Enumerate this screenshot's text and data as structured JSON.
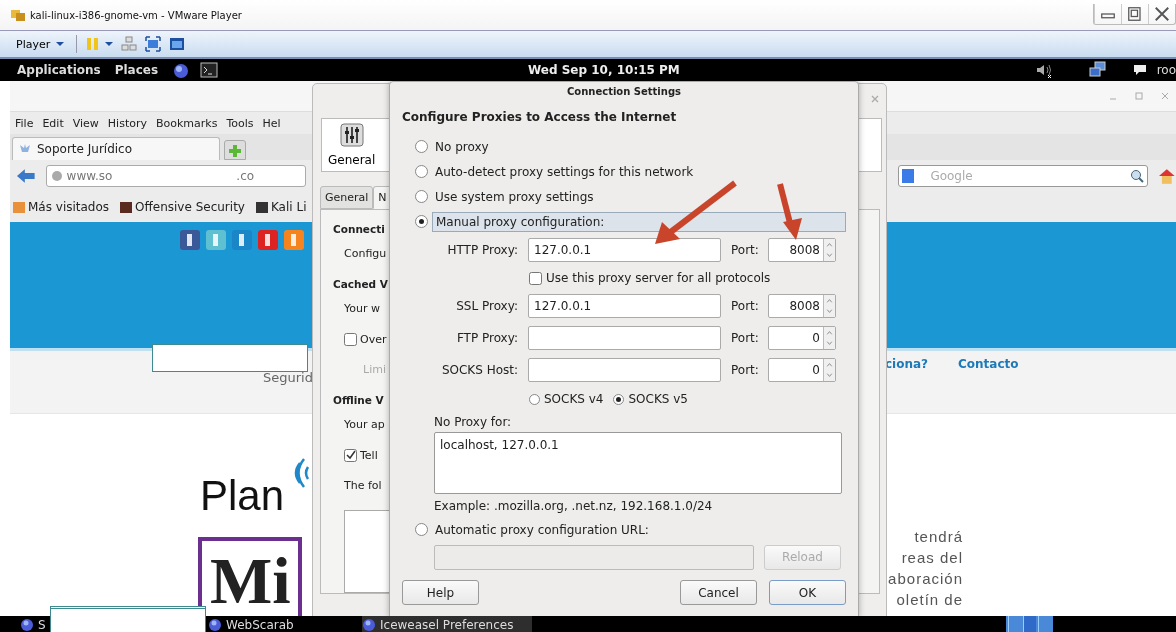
{
  "vm_window": {
    "title": "kali-linux-i386-gnome-vm - VMware Player",
    "player_menu": "Player"
  },
  "top_bar": {
    "menus": [
      "Applications",
      "Places"
    ],
    "clock": "Wed Sep 10, 10:15 PM",
    "user": "roo"
  },
  "browser": {
    "menu": [
      "File",
      "Edit",
      "View",
      "History",
      "Bookmarks",
      "Tools",
      "Hel"
    ],
    "tabs": [
      {
        "label": "Soporte Jurídico",
        "selected": true
      }
    ],
    "url_start": "www.so",
    "url_end": ".co",
    "search": {
      "placeholder": "Google"
    },
    "bookmarks": [
      "Más visitados",
      "Offensive Security",
      "Kali Li"
    ],
    "page": {
      "nav_left": "Segurid",
      "nav_right": [
        "ciona?",
        "Contacto"
      ],
      "logo_text": "Plan",
      "logo_box": "Mi",
      "body_lines": [
        "tendrá",
        "reas del",
        "aboración",
        "oletín de"
      ]
    }
  },
  "preferences": {
    "toolbar_item": "General",
    "tabs": [
      {
        "label": "General",
        "selected": false
      },
      {
        "label": "N",
        "selected": true
      }
    ],
    "items": [
      {
        "kind": "heading",
        "text": "Connecti"
      },
      {
        "kind": "text",
        "text": "Configu"
      },
      {
        "kind": "heading",
        "text": "Cached V"
      },
      {
        "kind": "text",
        "text": "Your w"
      },
      {
        "kind": "checkbox",
        "text": "Over",
        "checked": false
      },
      {
        "kind": "disabled",
        "text": "Limi"
      },
      {
        "kind": "heading",
        "text": "Offline V"
      },
      {
        "kind": "text",
        "text": "Your ap"
      },
      {
        "kind": "checkbox",
        "text": "Tell",
        "checked": true
      },
      {
        "kind": "text",
        "text": "The fol"
      },
      {
        "kind": "list"
      }
    ]
  },
  "dialog": {
    "title": "Connection Settings",
    "heading": "Configure Proxies to Access the Internet",
    "modes": [
      {
        "label": "No proxy",
        "selected": false
      },
      {
        "label": "Auto-detect proxy settings for this network",
        "selected": false
      },
      {
        "label": "Use system proxy settings",
        "selected": false
      },
      {
        "label": "Manual proxy configuration:",
        "selected": true
      }
    ],
    "proxies": [
      {
        "label": "HTTP Proxy:",
        "value": "127.0.0.1",
        "port_label": "Port:",
        "port": "8008"
      },
      {
        "label": "SSL Proxy:",
        "value": "127.0.0.1",
        "port_label": "Port:",
        "port": "8008"
      },
      {
        "label": "FTP Proxy:",
        "port_label": "Port:",
        "port": "0"
      },
      {
        "label": "SOCKS Host:",
        "port_label": "Port:",
        "port": "0"
      }
    ],
    "share_all": {
      "label": "Use this proxy server for all protocols",
      "checked": false
    },
    "socks_versions": [
      {
        "label": "SOCKS v4",
        "selected": false
      },
      {
        "label": "SOCKS v5",
        "selected": true
      }
    ],
    "no_proxy_label": "No Proxy for:",
    "no_proxy": "localhost, 127.0.0.1",
    "example": "Example: .mozilla.org, .net.nz, 192.168.1.0/24",
    "auto_url": {
      "label": "Automatic proxy configuration URL:",
      "selected": false
    },
    "reload": {
      "label": "Reload",
      "disabled": true
    },
    "buttons": [
      "Help",
      "Cancel",
      "OK"
    ]
  },
  "taskbar": {
    "items": [
      {
        "label": "S",
        "selected": false
      },
      {
        "label": "WebScarab",
        "selected": false
      },
      {
        "label": "Iceweasel Preferences",
        "selected": true
      }
    ]
  }
}
